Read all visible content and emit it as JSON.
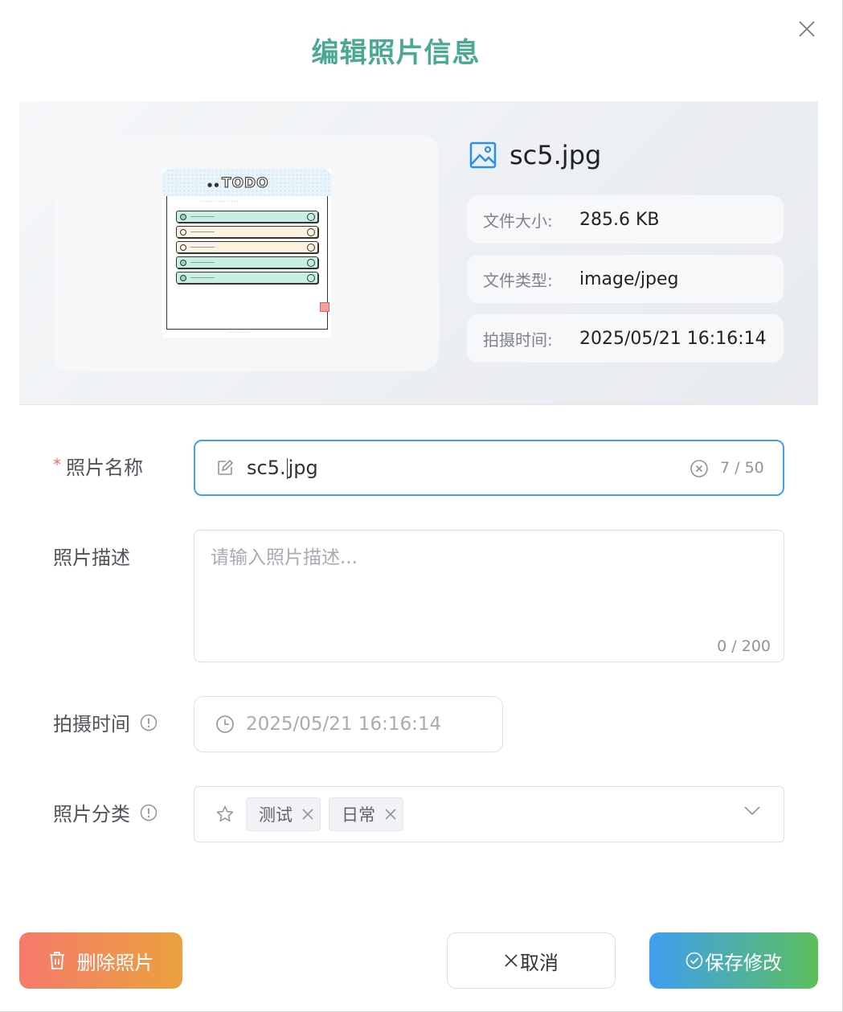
{
  "dialog": {
    "title": "编辑照片信息",
    "close_icon": "close-icon"
  },
  "preview": {
    "thumbnail": {
      "logo": "TODO",
      "items_checked": [
        true,
        false,
        false,
        true,
        true
      ]
    }
  },
  "file": {
    "name": "sc5.jpg",
    "icon": "image-icon",
    "meta": [
      {
        "key": "文件大小:",
        "value": "285.6 KB"
      },
      {
        "key": "文件类型:",
        "value": "image/jpeg"
      },
      {
        "key": "拍摄时间:",
        "value": "2025/05/21 16:16:14"
      }
    ]
  },
  "form": {
    "name": {
      "label": "照片名称",
      "required_mark": "*",
      "value_before_caret": "sc5.",
      "value_after_caret": "jpg",
      "count": "7 / 50",
      "icon": "edit-icon"
    },
    "description": {
      "label": "照片描述",
      "placeholder": "请输入照片描述...",
      "count": "0 / 200"
    },
    "taken_time": {
      "label": "拍摄时间",
      "value": "2025/05/21 16:16:14",
      "icon": "clock-icon"
    },
    "category": {
      "label": "照片分类",
      "icon": "star-icon",
      "tags": [
        "测试",
        "日常"
      ]
    }
  },
  "footer": {
    "delete_label": "删除照片",
    "cancel_label": "取消",
    "save_label": "保存修改"
  },
  "colors": {
    "title": "#4ba892",
    "focus_border": "#409eff",
    "required": "#f56c6c"
  }
}
